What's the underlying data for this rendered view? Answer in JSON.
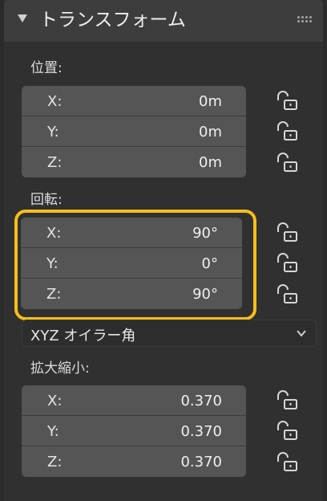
{
  "header": {
    "title": "トランスフォーム"
  },
  "location": {
    "label": "位置:",
    "rows": [
      {
        "axis": "X:",
        "value": "0m"
      },
      {
        "axis": "Y:",
        "value": "0m"
      },
      {
        "axis": "Z:",
        "value": "0m"
      }
    ]
  },
  "rotation": {
    "label": "回転:",
    "rows": [
      {
        "axis": "X:",
        "value": "90°"
      },
      {
        "axis": "Y:",
        "value": "0°"
      },
      {
        "axis": "Z:",
        "value": "90°"
      }
    ],
    "mode": "XYZ オイラー角"
  },
  "scale": {
    "label": "拡大縮小:",
    "rows": [
      {
        "axis": "X:",
        "value": "0.370"
      },
      {
        "axis": "Y:",
        "value": "0.370"
      },
      {
        "axis": "Z:",
        "value": "0.370"
      }
    ]
  },
  "colors": {
    "highlight": "#f5be1a",
    "field_bg": "#555555",
    "panel_bg": "#303030"
  },
  "icons": {
    "collapse": "triangle-down-icon",
    "drag": "drag-handle-icon",
    "lock": "unlocked-padlock-icon",
    "dropdown": "chevron-down-icon"
  }
}
